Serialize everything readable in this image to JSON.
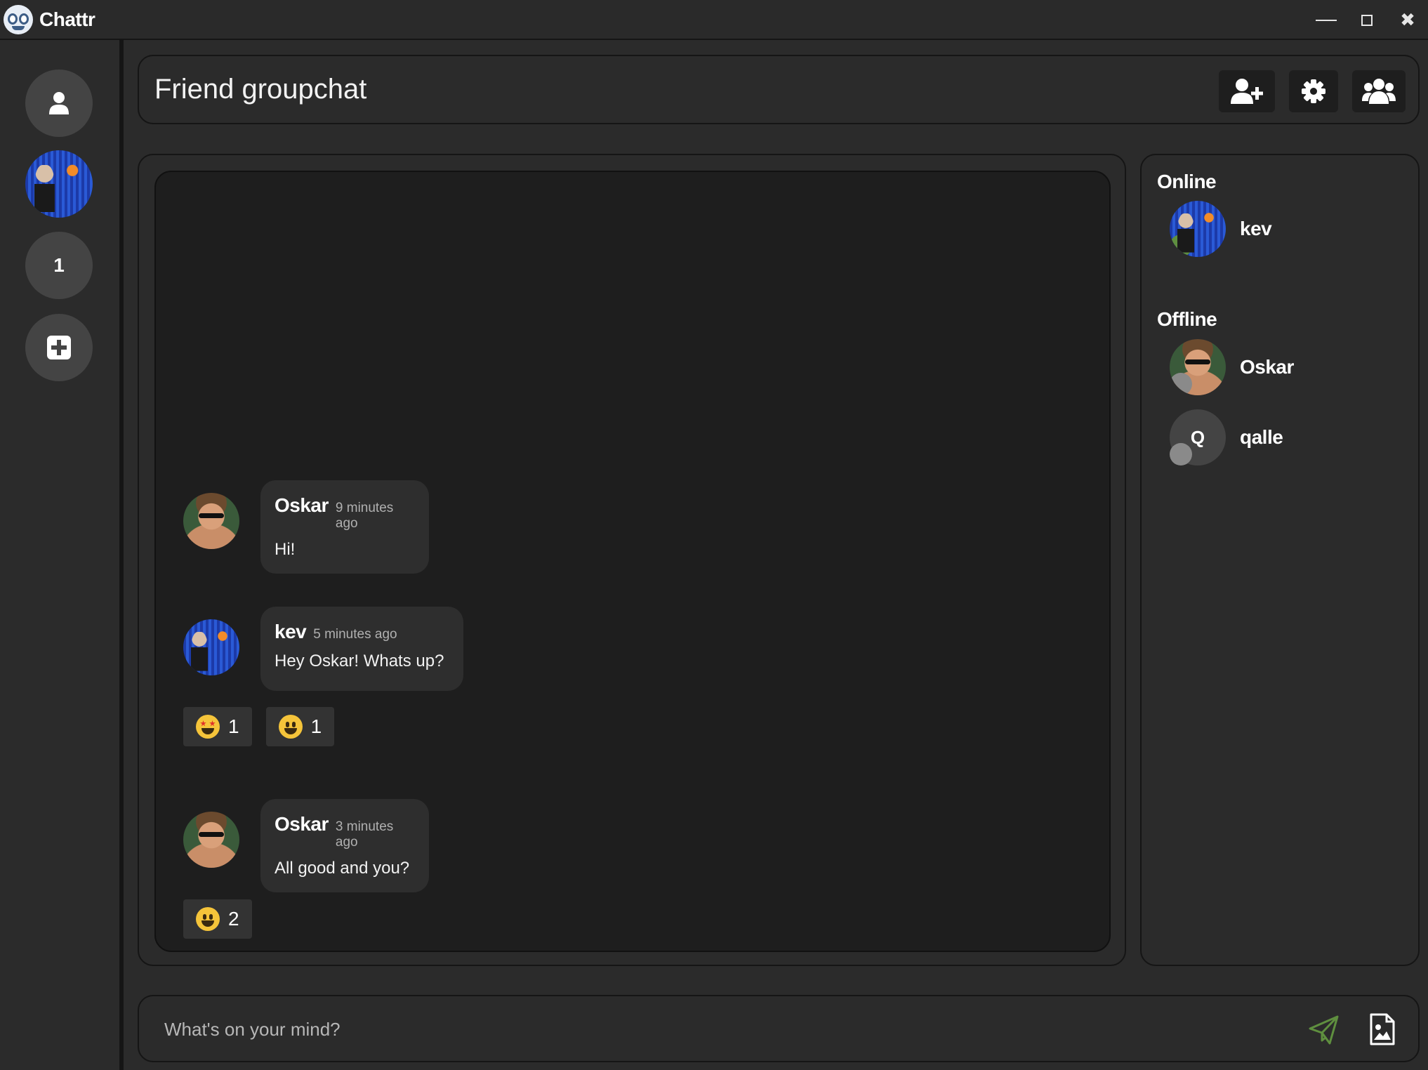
{
  "app": {
    "title": "Chattr"
  },
  "window_controls": {
    "minimize": "minimize-icon",
    "maximize": "maximize-icon",
    "close": "✖"
  },
  "rail": {
    "items": [
      {
        "kind": "profile",
        "icon": "user-icon"
      },
      {
        "kind": "chat-avatar",
        "icon": "kev-avatar"
      },
      {
        "kind": "chat-number",
        "label": "1"
      },
      {
        "kind": "add",
        "icon": "plus-square-icon"
      }
    ]
  },
  "header": {
    "title": "Friend groupchat",
    "actions": [
      "add-user-icon",
      "gear-icon",
      "users-icon"
    ]
  },
  "messages": [
    {
      "author": "Oskar",
      "time": "9 minutes ago",
      "text": "Hi!",
      "reactions": []
    },
    {
      "author": "kev",
      "time": "5 minutes ago",
      "text": "Hey Oskar! Whats up?",
      "reactions": [
        {
          "emoji": "star-struck",
          "count": "1"
        },
        {
          "emoji": "grinning",
          "count": "1"
        }
      ]
    },
    {
      "author": "Oskar",
      "time": "3 minutes ago",
      "text": "All good and you?",
      "reactions": [
        {
          "emoji": "grinning",
          "count": "2"
        }
      ]
    }
  ],
  "members": {
    "online_label": "Online",
    "offline_label": "Offline",
    "online": [
      {
        "name": "kev",
        "status": "online"
      }
    ],
    "offline": [
      {
        "name": "Oskar",
        "status": "offline"
      },
      {
        "name": "qalle",
        "initial": "Q",
        "status": "offline"
      }
    ]
  },
  "composer": {
    "placeholder": "What's on your mind?",
    "send_icon": "paper-plane-icon",
    "attach_icon": "image-file-icon"
  },
  "colors": {
    "background": "#2b2b2b",
    "panel_inner": "#1e1e1e",
    "bubble": "#2e2e2e",
    "online": "#5f8f3f",
    "offline": "#8a8a8a",
    "send_accent": "#5f8f3f"
  }
}
